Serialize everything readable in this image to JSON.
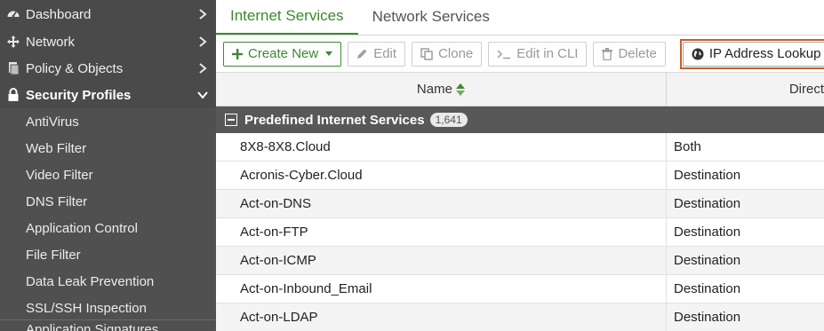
{
  "sidebar": {
    "top_items": [
      {
        "label": "Dashboard"
      },
      {
        "label": "Network"
      },
      {
        "label": "Policy & Objects"
      },
      {
        "label": "Security Profiles"
      }
    ],
    "sub_items": [
      {
        "label": "AntiVirus"
      },
      {
        "label": "Web Filter"
      },
      {
        "label": "Video Filter"
      },
      {
        "label": "DNS Filter"
      },
      {
        "label": "Application Control"
      },
      {
        "label": "File Filter"
      },
      {
        "label": "Data Leak Prevention"
      },
      {
        "label": "SSL/SSH Inspection"
      },
      {
        "label": "Application Signatures"
      }
    ]
  },
  "tabs": [
    {
      "label": "Internet Services"
    },
    {
      "label": "Network Services"
    }
  ],
  "toolbar": {
    "create_new": "Create New",
    "edit": "Edit",
    "clone": "Clone",
    "edit_in_cli": "Edit in CLI",
    "delete": "Delete",
    "ip_lookup": "IP Address Lookup"
  },
  "table": {
    "columns": {
      "name": "Name",
      "direction": "Direct"
    },
    "group": {
      "label": "Predefined Internet Services",
      "count": "1,641"
    },
    "rows": [
      {
        "name": "8X8-8X8.Cloud",
        "direction": "Both"
      },
      {
        "name": "Acronis-Cyber.Cloud",
        "direction": "Destination"
      },
      {
        "name": "Act-on-DNS",
        "direction": "Destination"
      },
      {
        "name": "Act-on-FTP",
        "direction": "Destination"
      },
      {
        "name": "Act-on-ICMP",
        "direction": "Destination"
      },
      {
        "name": "Act-on-Inbound_Email",
        "direction": "Destination"
      },
      {
        "name": "Act-on-LDAP",
        "direction": "Destination"
      }
    ]
  },
  "colors": {
    "accent": "#3b8a2e",
    "highlight_border": "#c0622f",
    "sidebar_bg": "#505050"
  }
}
